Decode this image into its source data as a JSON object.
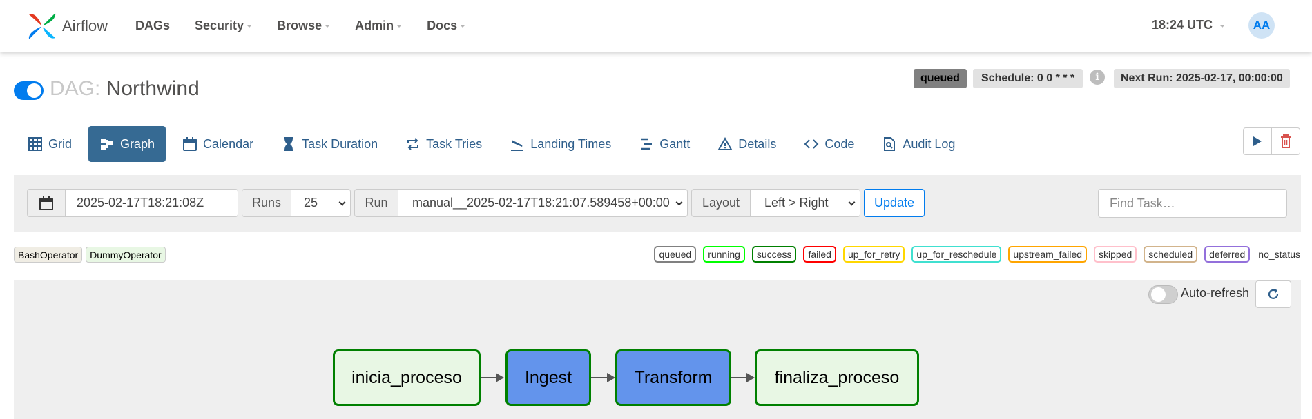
{
  "nav": {
    "brand": "Airflow",
    "items": [
      {
        "label": "DAGs",
        "dropdown": false
      },
      {
        "label": "Security",
        "dropdown": true
      },
      {
        "label": "Browse",
        "dropdown": true
      },
      {
        "label": "Admin",
        "dropdown": true
      },
      {
        "label": "Docs",
        "dropdown": true
      }
    ],
    "time": "18:24 UTC",
    "avatar_initials": "AA"
  },
  "dag": {
    "prefix": "DAG:",
    "name": "Northwind",
    "paused": false,
    "status_badge": "queued",
    "schedule": "Schedule: 0 0 * * *",
    "next_run": "Next Run: 2025-02-17, 00:00:00"
  },
  "tabs": [
    {
      "label": "Grid",
      "icon": "grid-icon"
    },
    {
      "label": "Graph",
      "icon": "graph-icon",
      "active": true
    },
    {
      "label": "Calendar",
      "icon": "calendar-icon"
    },
    {
      "label": "Task Duration",
      "icon": "hourglass-icon"
    },
    {
      "label": "Task Tries",
      "icon": "retry-icon"
    },
    {
      "label": "Landing Times",
      "icon": "plane-landing-icon"
    },
    {
      "label": "Gantt",
      "icon": "gantt-icon"
    },
    {
      "label": "Details",
      "icon": "warning-triangle-icon"
    },
    {
      "label": "Code",
      "icon": "code-icon"
    },
    {
      "label": "Audit Log",
      "icon": "file-search-icon"
    }
  ],
  "controls": {
    "base_date": "2025-02-17T18:21:08Z",
    "runs_label": "Runs",
    "runs_value": "25",
    "run_label": "Run",
    "run_value": "manual__2025-02-17T18:21:07.589458+00:00",
    "layout_label": "Layout",
    "layout_value": "Left > Right",
    "update_label": "Update",
    "find_placeholder": "Find Task…"
  },
  "operator_legend": [
    {
      "label": "BashOperator",
      "color": "#f0ede4"
    },
    {
      "label": "DummyOperator",
      "color": "#e8f7e4"
    }
  ],
  "state_legend": [
    {
      "label": "queued",
      "color": "#808080"
    },
    {
      "label": "running",
      "color": "#00ff00"
    },
    {
      "label": "success",
      "color": "#008000"
    },
    {
      "label": "failed",
      "color": "#ff0000"
    },
    {
      "label": "up_for_retry",
      "color": "#ffd700"
    },
    {
      "label": "up_for_reschedule",
      "color": "#40e0d0"
    },
    {
      "label": "upstream_failed",
      "color": "#ffa500"
    },
    {
      "label": "skipped",
      "color": "#ffc0cb"
    },
    {
      "label": "scheduled",
      "color": "#d2b48c"
    },
    {
      "label": "deferred",
      "color": "#9370db"
    },
    {
      "label": "no_status",
      "color": null
    }
  ],
  "graph": {
    "auto_refresh_label": "Auto-refresh",
    "auto_refresh_on": false,
    "nodes": [
      {
        "label": "inicia_proceso",
        "type": "bash"
      },
      {
        "label": "Ingest",
        "type": "dummy"
      },
      {
        "label": "Transform",
        "type": "dummy"
      },
      {
        "label": "finaliza_proceso",
        "type": "bash"
      }
    ]
  }
}
